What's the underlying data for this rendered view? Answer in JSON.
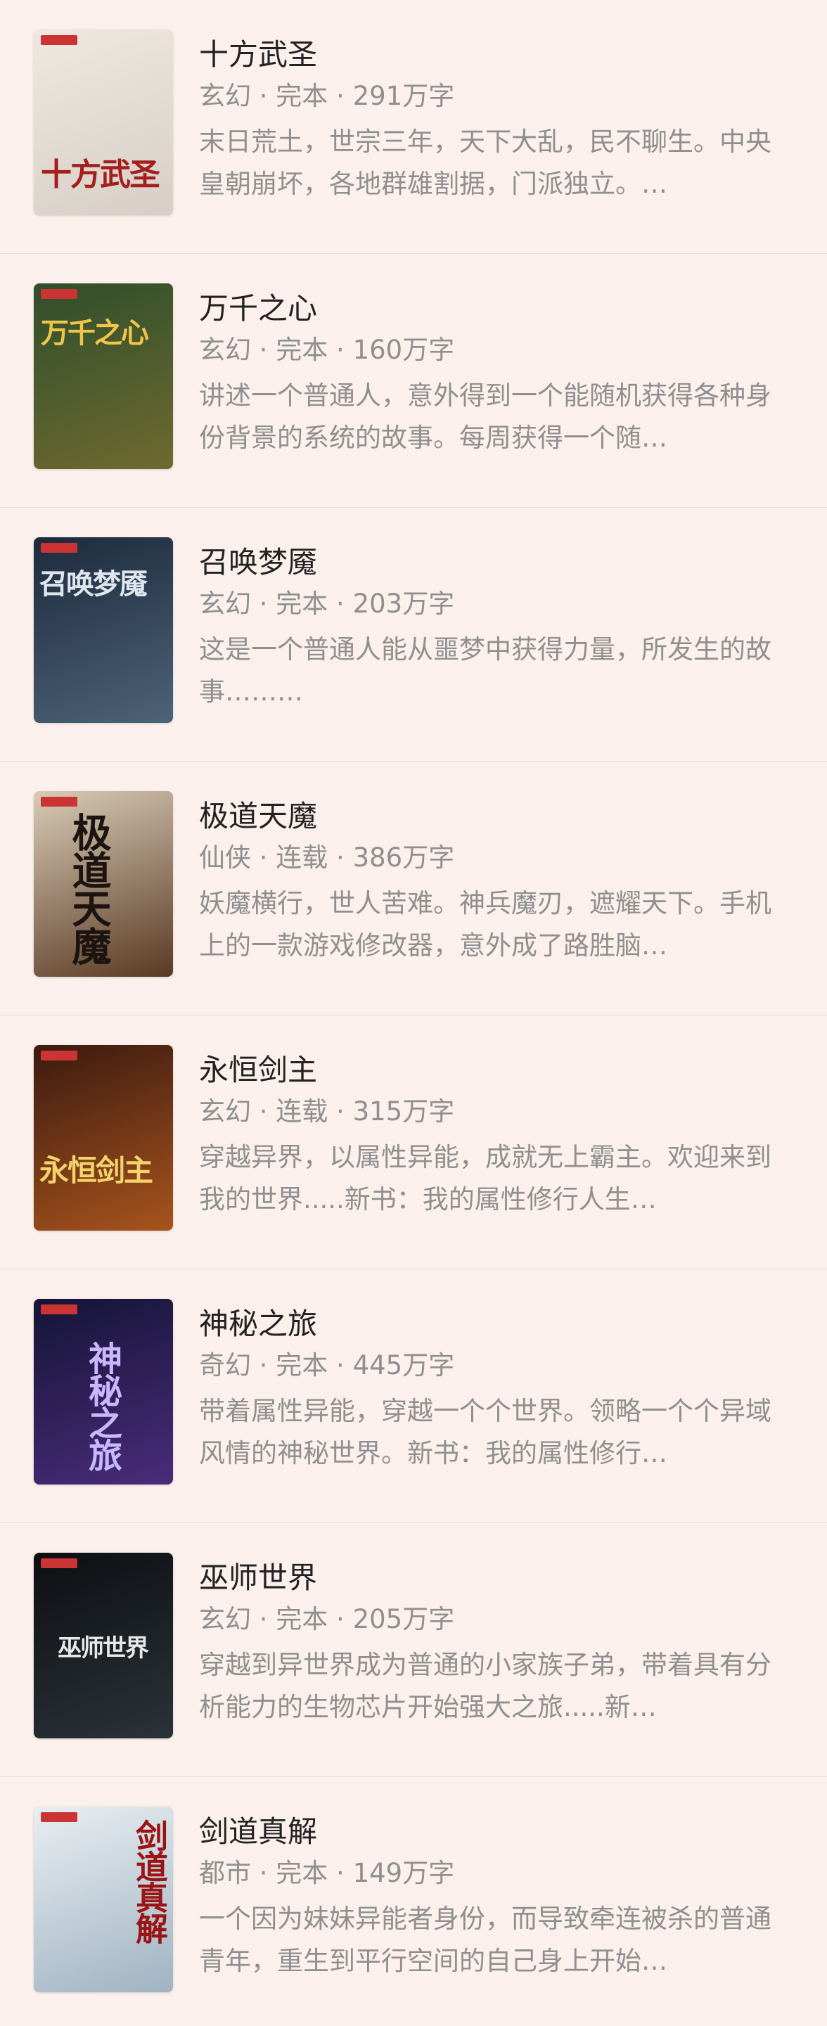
{
  "books": [
    {
      "title": "十方武圣",
      "meta": "玄幻 · 完本 · 291万字",
      "desc": "末日荒土，世宗三年，天下大乱，民不聊生。中央皇朝崩坏，各地群雄割据，门派独立。…",
      "cover_art": "十方武圣",
      "cover_colors": [
        "#efe8e0",
        "#d7cfc6"
      ],
      "art_color": "#a51e1e"
    },
    {
      "title": "万千之心",
      "meta": "玄幻 · 完本 · 160万字",
      "desc": "讲述一个普通人，意外得到一个能随机获得各种身份背景的系统的故事。每周获得一个随…",
      "cover_art": "万千之心",
      "cover_colors": [
        "#2f4e2c",
        "#6f6a2f"
      ],
      "art_color": "#f0c64a"
    },
    {
      "title": "召唤梦魇",
      "meta": "玄幻 · 完本 · 203万字",
      "desc": "这是一个普通人能从噩梦中获得力量，所发生的故事………",
      "cover_art": "召唤梦魇",
      "cover_colors": [
        "#1d2a3d",
        "#4d6378"
      ],
      "art_color": "#dfe6ee"
    },
    {
      "title": "极道天魔",
      "meta": "仙侠 · 连载 · 386万字",
      "desc": "妖魔横行，世人苦难。神兵魔刃，遮耀天下。手机上的一款游戏修改器，意外成了路胜脑…",
      "cover_art": "极道天魔",
      "cover_colors": [
        "#d8cbb6",
        "#5a3a24"
      ],
      "art_color": "#1b1410"
    },
    {
      "title": "永恒剑主",
      "meta": "玄幻 · 连载 · 315万字",
      "desc": "穿越异界，以属性异能，成就无上霸主。欢迎来到我的世界.....新书：我的属性修行人生…",
      "cover_art": "永恒剑主",
      "cover_colors": [
        "#3b1a10",
        "#a8541d"
      ],
      "art_color": "#f3d36a"
    },
    {
      "title": "神秘之旅",
      "meta": "奇幻 · 完本 · 445万字",
      "desc": "带着属性异能，穿越一个个世界。领略一个个异域风情的神秘世界。新书：我的属性修行…",
      "cover_art": "神秘之旅",
      "cover_colors": [
        "#141437",
        "#4a2c7a"
      ],
      "art_color": "#c9b8ff"
    },
    {
      "title": "巫师世界",
      "meta": "玄幻 · 完本 · 205万字",
      "desc": "穿越到异世界成为普通的小家族子弟，带着具有分析能力的生物芯片开始强大之旅.....新…",
      "cover_art": "巫师世界",
      "cover_colors": [
        "#0d0f12",
        "#2b3338"
      ],
      "art_color": "#e8e8e8"
    },
    {
      "title": "剑道真解",
      "meta": "都市 · 完本 · 149万字",
      "desc": "一个因为妹妹异能者身份，而导致牵连被杀的普通青年，重生到平行空间的自己身上开始…",
      "cover_art": "剑道真解",
      "cover_colors": [
        "#e9eef2",
        "#9fb3c2"
      ],
      "art_color": "#9a1414"
    }
  ]
}
